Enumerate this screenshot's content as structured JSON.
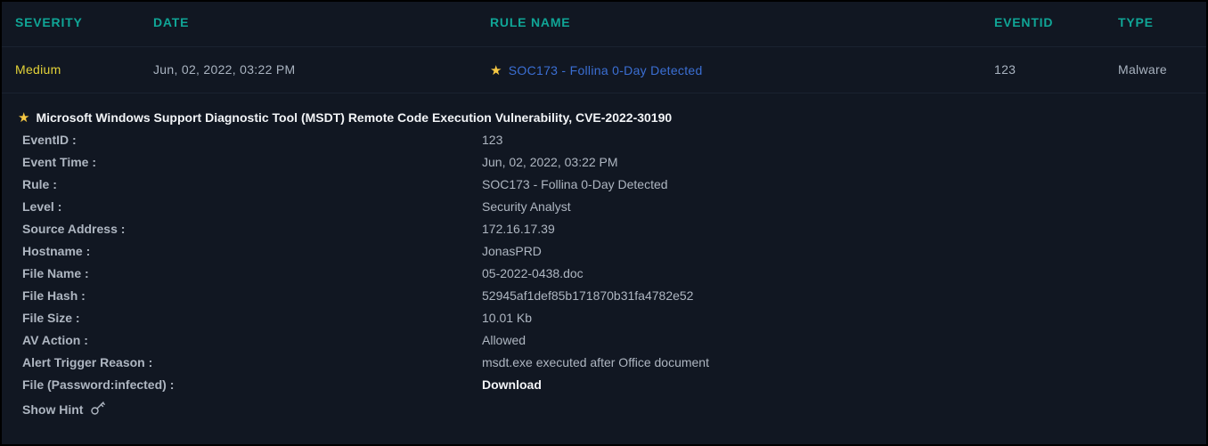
{
  "header": {
    "severity": "SEVERITY",
    "date": "DATE",
    "rule_name": "RULE NAME",
    "eventid": "EVENTID",
    "type": "TYPE"
  },
  "row": {
    "severity": "Medium",
    "date": "Jun, 02, 2022, 03:22 PM",
    "rule_name": "SOC173 - Follina 0-Day Detected",
    "eventid": "123",
    "type": "Malware"
  },
  "details": {
    "title": "Microsoft Windows Support Diagnostic Tool (MSDT) Remote Code Execution Vulnerability, CVE-2022-30190",
    "fields": [
      {
        "label": "EventID :",
        "value": "123"
      },
      {
        "label": "Event Time :",
        "value": "Jun, 02, 2022, 03:22 PM"
      },
      {
        "label": "Rule :",
        "value": "SOC173 - Follina 0-Day Detected"
      },
      {
        "label": "Level :",
        "value": "Security Analyst"
      },
      {
        "label": "Source Address :",
        "value": "172.16.17.39"
      },
      {
        "label": "Hostname :",
        "value": "JonasPRD"
      },
      {
        "label": "File Name :",
        "value": "05-2022-0438.doc"
      },
      {
        "label": "File Hash :",
        "value": "52945af1def85b171870b31fa4782e52"
      },
      {
        "label": "File Size :",
        "value": "10.01 Kb"
      },
      {
        "label": "AV Action :",
        "value": "Allowed"
      },
      {
        "label": "Alert Trigger Reason :",
        "value": "msdt.exe executed after Office document"
      },
      {
        "label": "File (Password:infected) :",
        "value": "Download"
      }
    ],
    "show_hint": "Show Hint"
  },
  "icons": {
    "star": "star-icon",
    "hint": "key-icon"
  },
  "colors": {
    "accent_teal": "#10a596",
    "severity_medium": "#e4d338",
    "link_blue": "#3b6fd4",
    "star_gold": "#f6c843"
  }
}
